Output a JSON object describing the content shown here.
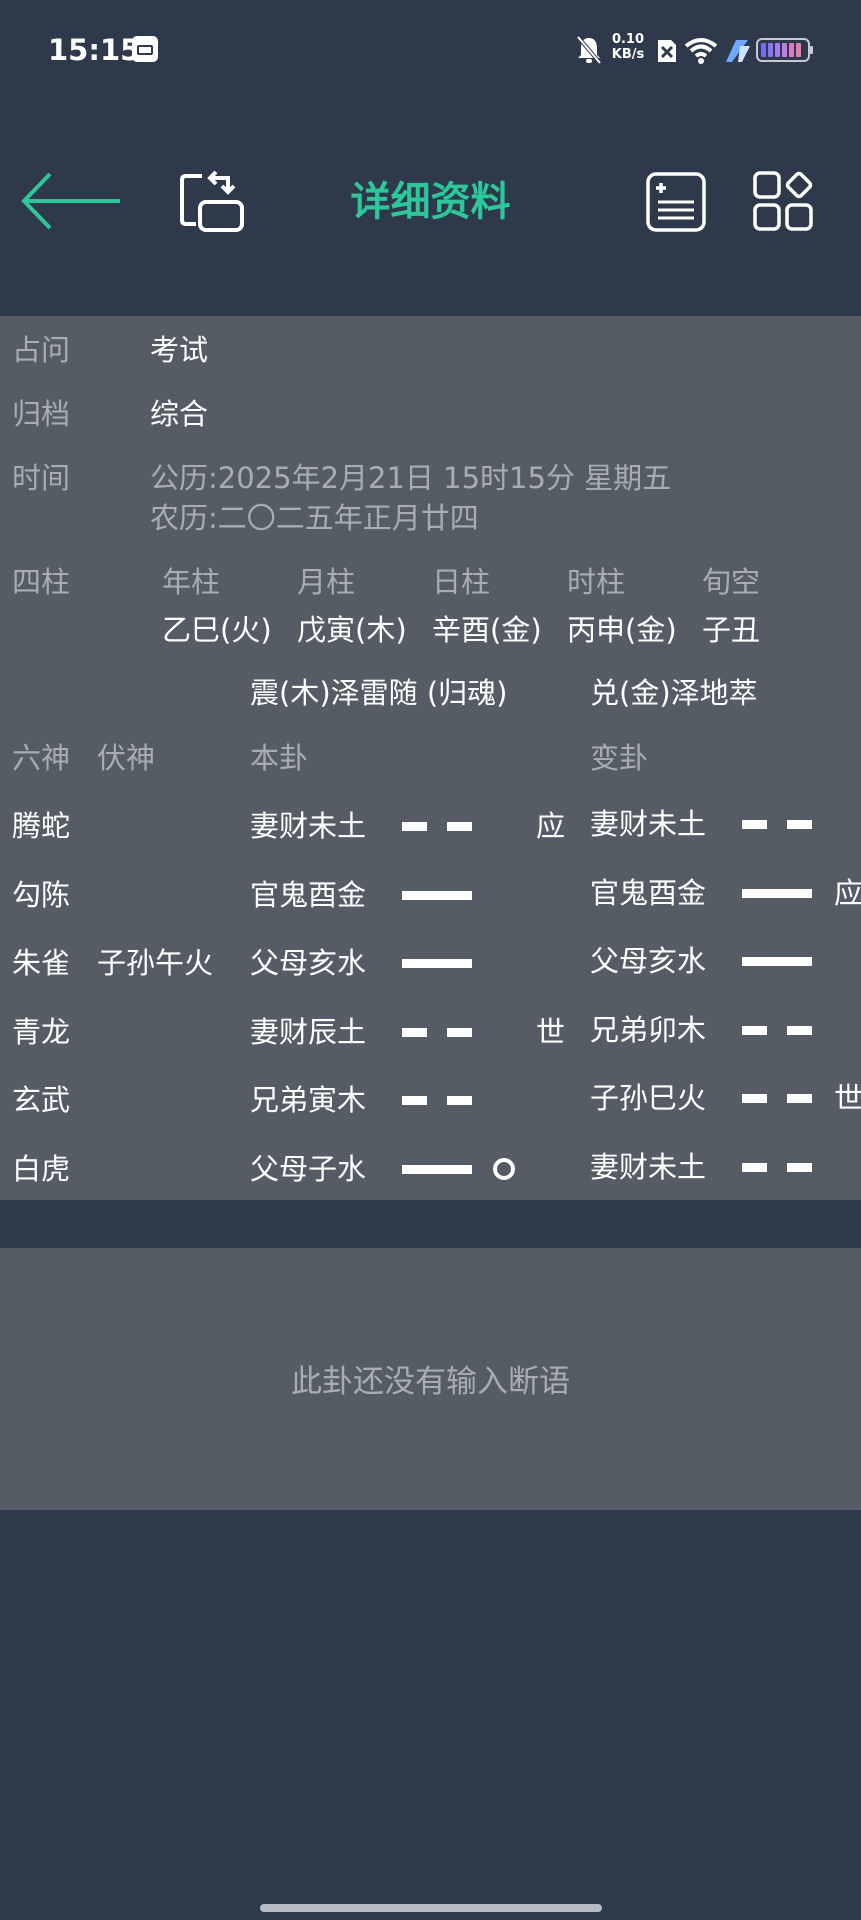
{
  "status": {
    "time": "15:15",
    "speed_value": "0.10",
    "speed_unit": "KB/s",
    "icons": [
      "calendar-icon",
      "bell-muted-icon",
      "sim-none-icon",
      "wifi-icon",
      "charging-icon",
      "battery-icon"
    ]
  },
  "toolbar": {
    "title": "详细资料",
    "icons": [
      "back-arrow-icon",
      "swap-icon",
      "add-note-icon",
      "apps-grid-icon"
    ],
    "accent": "#2ec79a"
  },
  "info": {
    "question_label": "占问",
    "question_value": "考试",
    "category_label": "归档",
    "category_value": "综合",
    "time_label": "时间",
    "solar_date": "公历:2025年2月21日  15时15分 星期五",
    "lunar_date": "农历:二〇二五年正月廿四"
  },
  "pillars": {
    "label": "四柱",
    "headers": [
      "年柱",
      "月柱",
      "日柱",
      "时柱",
      "旬空"
    ],
    "values": [
      "乙巳(火)",
      "戊寅(木)",
      "辛酉(金)",
      "丙申(金)",
      "子丑"
    ]
  },
  "hexagram": {
    "main_name": "震(木)泽雷随 (归魂)",
    "changed_name": "兑(金)泽地萃",
    "col_six_spirits": "六神",
    "col_hidden": "伏神",
    "col_main": "本卦",
    "col_changed": "变卦",
    "rows": [
      {
        "spirit": "腾蛇",
        "hidden": "",
        "main": "妻财未土",
        "main_line": "yin",
        "moving": false,
        "main_mark": "应",
        "changed": "妻财未土",
        "changed_line": "yin",
        "changed_mark": ""
      },
      {
        "spirit": "勾陈",
        "hidden": "",
        "main": "官鬼酉金",
        "main_line": "yang",
        "moving": false,
        "main_mark": "",
        "changed": "官鬼酉金",
        "changed_line": "yang",
        "changed_mark": "应"
      },
      {
        "spirit": "朱雀",
        "hidden": "子孙午火",
        "main": "父母亥水",
        "main_line": "yang",
        "moving": false,
        "main_mark": "",
        "changed": "父母亥水",
        "changed_line": "yang",
        "changed_mark": ""
      },
      {
        "spirit": "青龙",
        "hidden": "",
        "main": "妻财辰土",
        "main_line": "yin",
        "moving": false,
        "main_mark": "世",
        "changed": "兄弟卯木",
        "changed_line": "yin",
        "changed_mark": ""
      },
      {
        "spirit": "玄武",
        "hidden": "",
        "main": "兄弟寅木",
        "main_line": "yin",
        "moving": false,
        "main_mark": "",
        "changed": "子孙巳火",
        "changed_line": "yin",
        "changed_mark": "世"
      },
      {
        "spirit": "白虎",
        "hidden": "",
        "main": "父母子水",
        "main_line": "yang",
        "moving": true,
        "main_mark": "",
        "changed": "妻财未土",
        "changed_line": "yin",
        "changed_mark": ""
      }
    ]
  },
  "note": {
    "empty_text": "此卦还没有输入断语"
  }
}
